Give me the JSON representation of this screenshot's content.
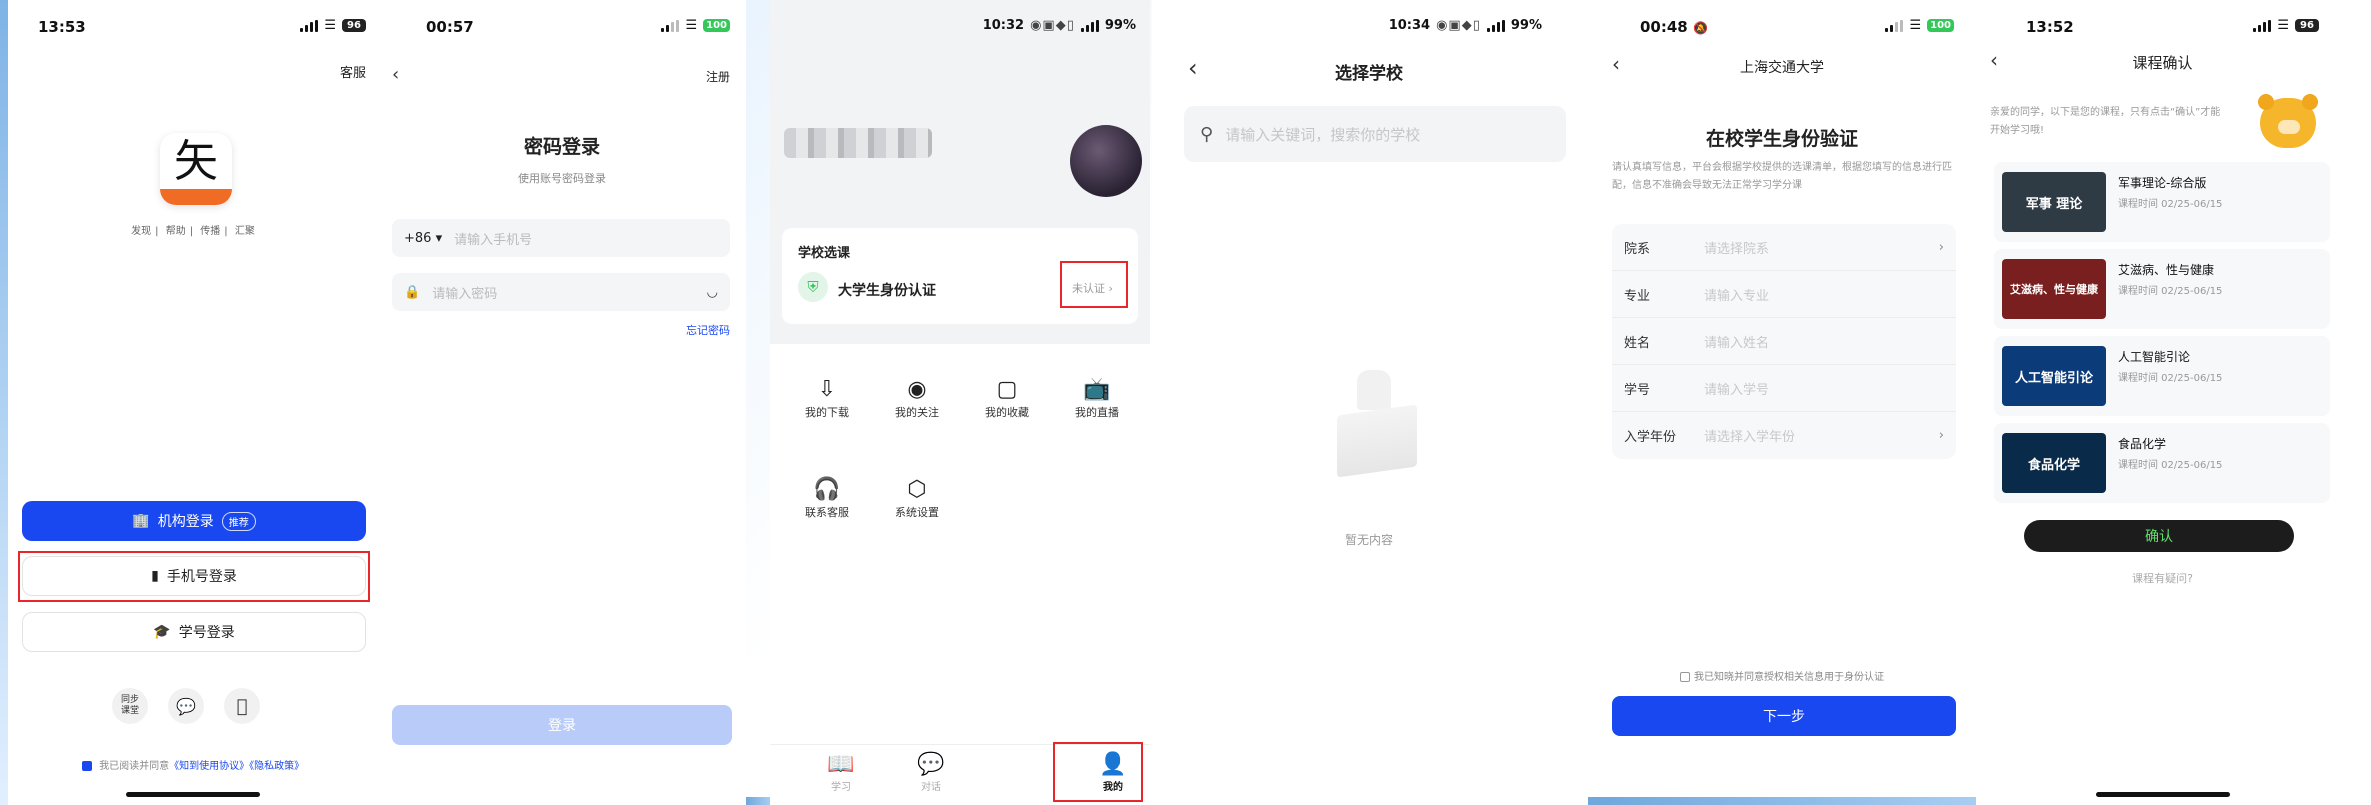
{
  "colors": {
    "primary": "#1a48f0",
    "highlight": "#e8262c",
    "green": "#34c759",
    "dark_button": "#1c1c1c"
  },
  "screen1": {
    "time": "13:53",
    "battery": "96",
    "service": "客服",
    "logo_text": "矢",
    "links": [
      "发现",
      "帮助",
      "传播",
      "汇聚"
    ],
    "btn_institution": "机构登录",
    "btn_institution_tag": "推荐",
    "btn_phone": "手机号登录",
    "btn_student": "学号登录",
    "social_sync": "同步\n课堂",
    "social_icons": [
      "wechat-icon",
      "apple-icon"
    ],
    "agree_prefix": "我已阅读并同意",
    "agree_links": "《知到使用协议》《隐私政策》"
  },
  "screen2": {
    "time": "00:57",
    "battery": "100",
    "register": "注册",
    "title": "密码登录",
    "subtitle": "使用账号密码登录",
    "country_code": "+86",
    "phone_placeholder": "请输入手机号",
    "password_placeholder": "请输入密码",
    "forgot": "忘记密码",
    "login_button": "登录"
  },
  "screen3": {
    "time": "10:32",
    "battery": "99%",
    "school_section": "学校选课",
    "verify_label": "大学生身份认证",
    "verify_status": "未认证",
    "grid": [
      {
        "icon": "download-icon",
        "label": "我的下载"
      },
      {
        "icon": "eye-icon",
        "label": "我的关注"
      },
      {
        "icon": "collect-icon",
        "label": "我的收藏"
      },
      {
        "icon": "tv-icon",
        "label": "我的直播"
      },
      {
        "icon": "headset-icon",
        "label": "联系客服"
      },
      {
        "icon": "settings-icon",
        "label": "系统设置"
      }
    ],
    "tabs": [
      "学习",
      "对话",
      "我的"
    ]
  },
  "screen4": {
    "time": "10:34",
    "battery": "99%",
    "title": "选择学校",
    "search_placeholder": "请输入关键词，搜索你的学校",
    "empty": "暂无内容"
  },
  "screen5": {
    "time": "00:48",
    "battery": "100",
    "header": "上海交通大学",
    "title": "在校学生身份验证",
    "desc": "请认真填写信息，平台会根据学校提供的选课清单，根据您填写的信息进行匹配，信息不准确会导致无法正常学习学分课",
    "fields": [
      {
        "label": "院系",
        "placeholder": "请选择院系",
        "select": true
      },
      {
        "label": "专业",
        "placeholder": "请输入专业",
        "select": false
      },
      {
        "label": "姓名",
        "placeholder": "请输入姓名",
        "select": false
      },
      {
        "label": "学号",
        "placeholder": "请输入学号",
        "select": false
      },
      {
        "label": "入学年份",
        "placeholder": "请选择入学年份",
        "select": true
      }
    ],
    "consent": "我已知晓并同意授权相关信息用于身份认证",
    "next": "下一步"
  },
  "screen6": {
    "time": "13:52",
    "battery": "96",
    "title": "课程确认",
    "intro": "亲爱的同学，以下是您的课程，只有点击“确认”才能开始学习哦!",
    "courses": [
      {
        "name": "军事理论-综合版",
        "time": "课程时间 02/25-06/15",
        "thumb": "军事 理论",
        "color": "#2e3b45"
      },
      {
        "name": "艾滋病、性与健康",
        "time": "课程时间 02/25-06/15",
        "thumb": "艾滋病、性与健康",
        "color": "#7a1f1f"
      },
      {
        "name": "人工智能引论",
        "time": "课程时间 02/25-06/15",
        "thumb": "人工智能引论",
        "color": "#0c3b7a"
      },
      {
        "name": "食品化学",
        "time": "课程时间 02/25-06/15",
        "thumb": "食品化学",
        "color": "#0a2a4a"
      }
    ],
    "confirm": "确认",
    "question": "课程有疑问?"
  }
}
